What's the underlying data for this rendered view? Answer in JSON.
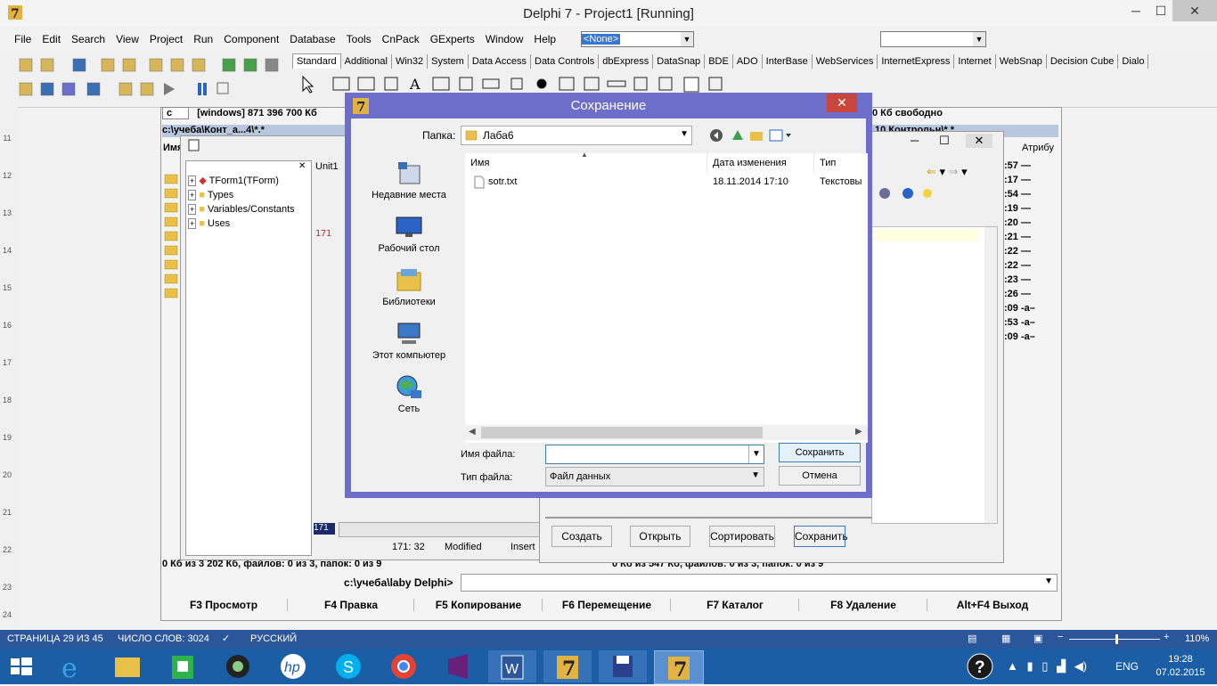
{
  "delphi": {
    "title": "Delphi 7 - Project1 [Running]",
    "menu": [
      "File",
      "Edit",
      "Search",
      "View",
      "Project",
      "Run",
      "Component",
      "Database",
      "Tools",
      "CnPack",
      "GExperts",
      "Window",
      "Help"
    ],
    "combo_none": "<None>",
    "palette_tabs": [
      "Standard",
      "Additional",
      "Win32",
      "System",
      "Data Access",
      "Data Controls",
      "dbExpress",
      "DataSnap",
      "BDE",
      "ADO",
      "InterBase",
      "WebServices",
      "InternetExpress",
      "Internet",
      "WebSnap",
      "Decision Cube",
      "Dialo"
    ],
    "active_tab": "Standard"
  },
  "commander": {
    "drive": "c",
    "drive_info": "[windows]  871 396 700 Кб",
    "free_right": "0 Кб свободно",
    "path_left": "c:\\учеба\\Конт_а...4\\*.*",
    "path_right": "10 Контрольн\\*.*",
    "col_name": "Имя",
    "col_attr": "Атрибу",
    "times": [
      ":57 —",
      ":17 —",
      ":54 —",
      ":19 —",
      ":20 —",
      ":21 —",
      ":22 —",
      ":22 —",
      ":23 —",
      ":26 —",
      ":09 -а–",
      ":53 -а–",
      ":09 -а–"
    ],
    "status_left": "0 Кб из 3 202 Кб, файлов: 0 из 3, папок: 0 из 9",
    "status_right": "0 Кб из 547 Кб, файлов: 0 из 3, папок: 0 из 9",
    "cmdline_path": "c:\\учеба\\laby Delphi>",
    "fkeys": [
      "F3 Просмотр",
      "F4 Правка",
      "F5 Копирование",
      "F6 Перемещение",
      "F7 Каталог",
      "F8 Удаление",
      "Alt+F4 Выход"
    ]
  },
  "explorer": {
    "tree": [
      "TForm1(TForm)",
      "Types",
      "Variables/Constants",
      "Uses"
    ],
    "unit_tab": "Unit1",
    "line_no": "171",
    "status_pos": "171:  32",
    "status_mod": "Modified",
    "status_ins": "Insert"
  },
  "app_form": {
    "buttons": [
      "Создать",
      "Открыть",
      "Сортировать",
      "Сохранить"
    ]
  },
  "dialog": {
    "title": "Сохранение",
    "folder_label": "Папка:",
    "folder_value": "Лаба6",
    "places": [
      "Недавние места",
      "Рабочий стол",
      "Библиотеки",
      "Этот компьютер",
      "Сеть"
    ],
    "columns": [
      "Имя",
      "Дата изменения",
      "Тип"
    ],
    "files": [
      {
        "name": "sotr.txt",
        "date": "18.11.2014 17:10",
        "type": "Текстовы"
      }
    ],
    "filename_label": "Имя файла:",
    "filename_value": "",
    "filetype_label": "Тип файла:",
    "filetype_value": "Файл данных",
    "save_btn": "Сохранить",
    "cancel_btn": "Отмена"
  },
  "word_status": {
    "page": "СТРАНИЦА 29 ИЗ 45",
    "words": "ЧИСЛО СЛОВ: 3024",
    "lang": "РУССКИЙ",
    "zoom": "110%"
  },
  "taskbar": {
    "lang": "ENG",
    "time": "19:28",
    "date": "07.02.2015"
  }
}
